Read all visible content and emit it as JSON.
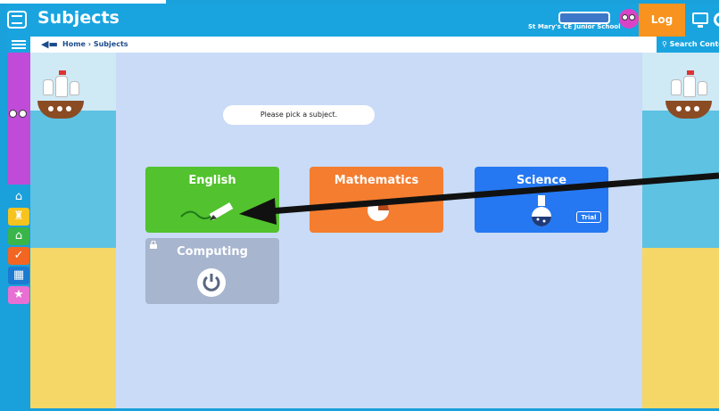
{
  "header": {
    "title": "Subjects",
    "school": "St Mary's CE Junior School",
    "logout_label": "Log Out"
  },
  "breadcrumb": {
    "home": "Home",
    "current": "Subjects",
    "separator": "›",
    "search_label": "Search Content"
  },
  "main": {
    "prompt": "Please pick a subject.",
    "subjects": [
      {
        "label": "English",
        "color": "#52c22e",
        "icon": "pencil-icon"
      },
      {
        "label": "Mathematics",
        "color": "#f47d2f",
        "icon": "pie-chart-icon"
      },
      {
        "label": "Science",
        "color": "#2578f2",
        "icon": "flask-icon",
        "badge": "Trial"
      },
      {
        "label": "Computing",
        "color": "#a7b5cf",
        "icon": "power-icon",
        "locked": true
      }
    ]
  },
  "sidebar": {
    "icons": [
      "home-icon",
      "school-icon",
      "classroom-icon",
      "check-icon",
      "leaderboard-icon",
      "trophy-icon"
    ]
  },
  "colors": {
    "topbar": "#19a4e0",
    "logout": "#f7931e",
    "main_bg": "#c9dbf6",
    "annotation_arrow": "#111111"
  }
}
